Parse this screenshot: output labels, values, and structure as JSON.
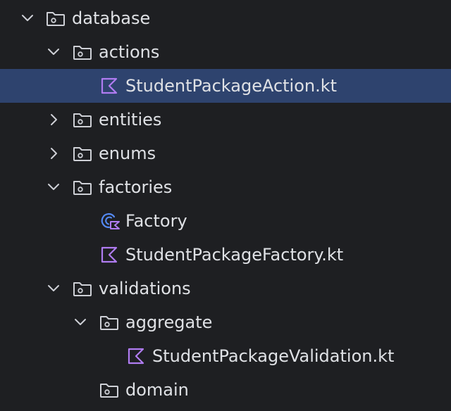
{
  "project_tree": {
    "items": [
      {
        "label": "database",
        "kind": "folder",
        "expanded": true,
        "selected": false
      },
      {
        "label": "actions",
        "kind": "folder",
        "expanded": true,
        "selected": false
      },
      {
        "label": "StudentPackageAction.kt",
        "kind": "kotlin-file",
        "selected": true
      },
      {
        "label": "entities",
        "kind": "folder",
        "expanded": false,
        "selected": false
      },
      {
        "label": "enums",
        "kind": "folder",
        "expanded": false,
        "selected": false
      },
      {
        "label": "factories",
        "kind": "folder",
        "expanded": true,
        "selected": false
      },
      {
        "label": "Factory",
        "kind": "kotlin-class",
        "selected": false
      },
      {
        "label": "StudentPackageFactory.kt",
        "kind": "kotlin-file",
        "selected": false
      },
      {
        "label": "validations",
        "kind": "folder",
        "expanded": true,
        "selected": false
      },
      {
        "label": "aggregate",
        "kind": "folder",
        "expanded": true,
        "selected": false
      },
      {
        "label": "StudentPackageValidation.kt",
        "kind": "kotlin-file",
        "selected": false
      },
      {
        "label": "domain",
        "kind": "folder",
        "expanded": false,
        "selected": false
      }
    ]
  },
  "colors": {
    "background": "#1e1f22",
    "selection": "#2e436e",
    "text": "#dfe1e5",
    "icon_gray": "#ced0d6",
    "kotlin_purple": "#b07cf2",
    "class_blue": "#548af7"
  }
}
